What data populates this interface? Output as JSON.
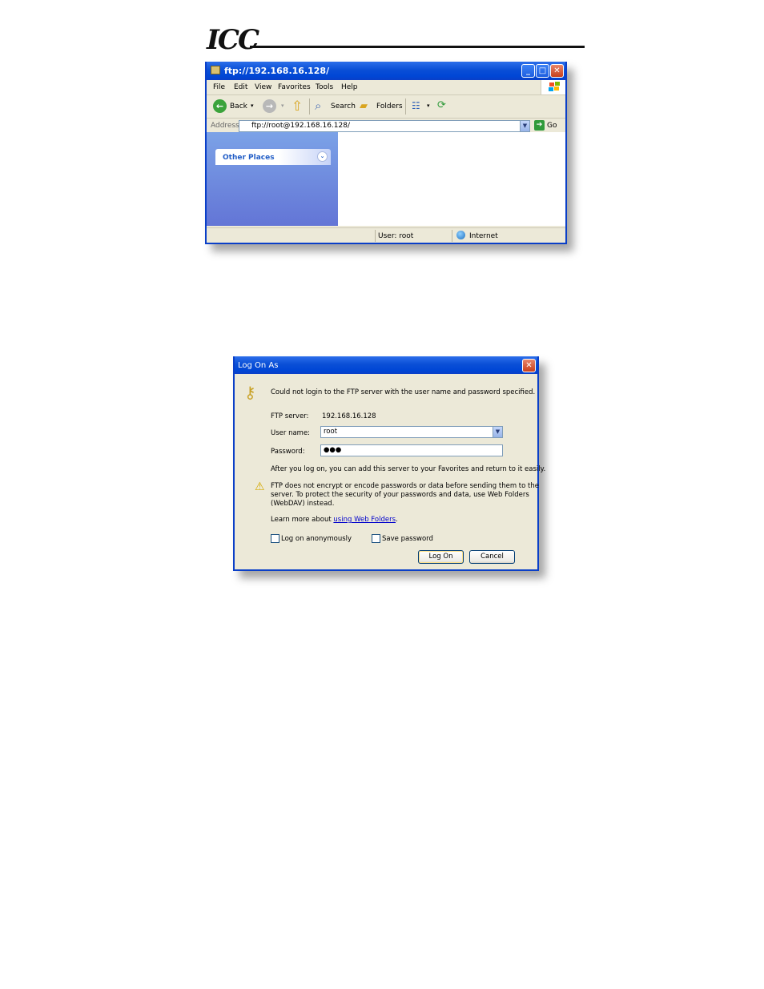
{
  "header": {
    "logo": "ICC"
  },
  "explorer": {
    "title": "ftp://192.168.16.128/",
    "menu": [
      "File",
      "Edit",
      "View",
      "Favorites",
      "Tools",
      "Help"
    ],
    "toolbar": {
      "back": "Back",
      "search": "Search",
      "folders": "Folders"
    },
    "address_label": "Address",
    "address_value": "ftp://root@192.168.16.128/",
    "go_label": "Go",
    "other_places": "Other Places",
    "status_user": "User: root",
    "status_zone": "Internet"
  },
  "dialog": {
    "title": "Log On As",
    "error_message": "Could not login to the FTP server with the user name and password specified.",
    "ftp_server_label": "FTP server:",
    "ftp_server_value": "192.168.16.128",
    "user_name_label": "User name:",
    "user_name_value": "root",
    "password_label": "Password:",
    "password_value": "●●●",
    "info_text": "After you log on, you can add this server to your Favorites and return to it easily.",
    "warning_line1": "FTP does not encrypt or encode passwords or data before sending them to the",
    "warning_line2": "server.  To protect the security of your passwords and data, use Web Folders",
    "warning_line3": "(WebDAV) instead.",
    "learn_prefix": "Learn more about ",
    "learn_link": "using Web Folders",
    "learn_suffix": ".",
    "anon_label": "Log on anonymously",
    "save_label": "Save password",
    "logon_button": "Log On",
    "cancel_button": "Cancel"
  }
}
